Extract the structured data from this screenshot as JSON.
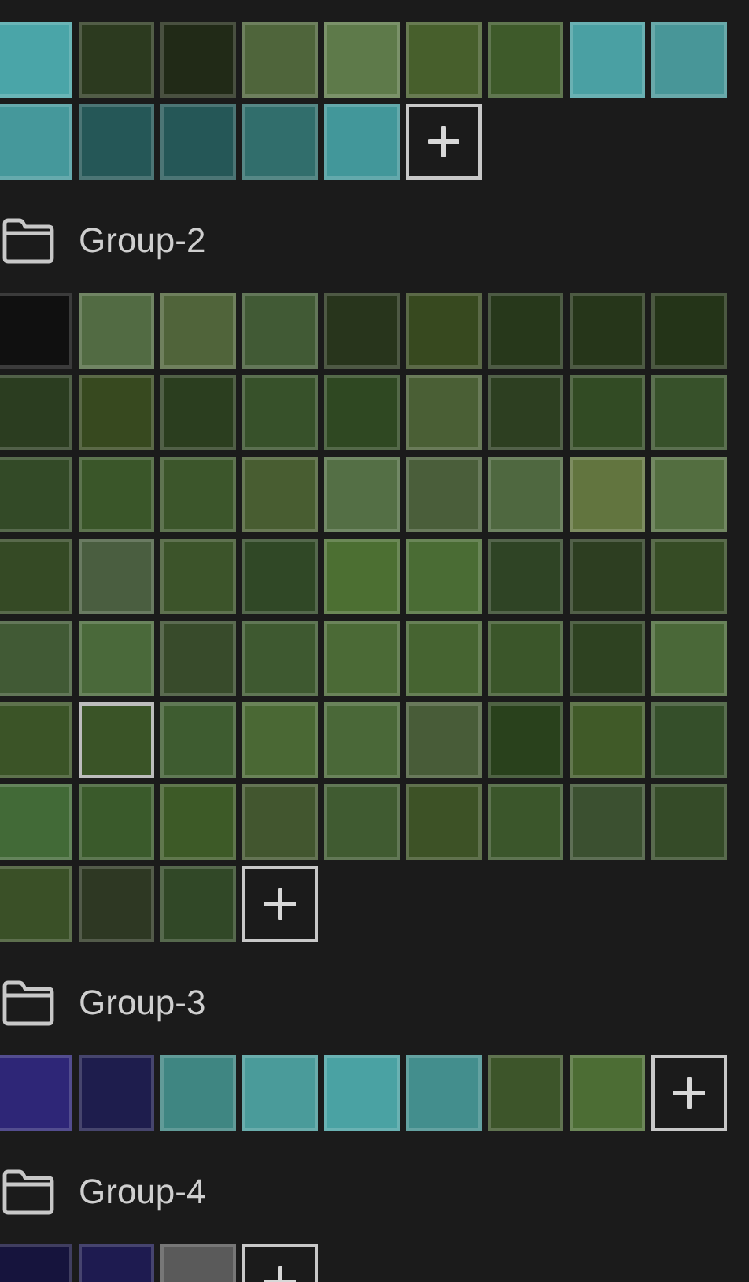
{
  "groups": [
    {
      "swatches": [
        {
          "color": "#4aa5a8",
          "selected": false
        },
        {
          "color": "#2c3a1f",
          "selected": false
        },
        {
          "color": "#212a17",
          "selected": false
        },
        {
          "color": "#4f653b",
          "selected": false
        },
        {
          "color": "#5e7a4a",
          "selected": false
        },
        {
          "color": "#475f2c",
          "selected": false
        },
        {
          "color": "#3e5a2a",
          "selected": false
        },
        {
          "color": "#4aa0a3",
          "selected": false
        },
        {
          "color": "#489698",
          "selected": false
        },
        {
          "color": "#45989b",
          "selected": false
        },
        {
          "color": "#255757",
          "selected": false
        },
        {
          "color": "#255757",
          "selected": false
        },
        {
          "color": "#316e6c",
          "selected": false
        },
        {
          "color": "#42979a",
          "selected": false
        }
      ]
    },
    {
      "name": "Group-2",
      "swatches": [
        {
          "color": "#101010",
          "selected": false
        },
        {
          "color": "#526b43",
          "selected": false
        },
        {
          "color": "#50643a",
          "selected": false
        },
        {
          "color": "#415a35",
          "selected": false
        },
        {
          "color": "#28351c",
          "selected": false
        },
        {
          "color": "#37491f",
          "selected": false
        },
        {
          "color": "#27381b",
          "selected": false
        },
        {
          "color": "#26361a",
          "selected": false
        },
        {
          "color": "#243418",
          "selected": false
        },
        {
          "color": "#2b3d20",
          "selected": false
        },
        {
          "color": "#37491f",
          "selected": false
        },
        {
          "color": "#2b3e1f",
          "selected": false
        },
        {
          "color": "#37512a",
          "selected": false
        },
        {
          "color": "#2f4822",
          "selected": false
        },
        {
          "color": "#4a5f35",
          "selected": false
        },
        {
          "color": "#2d3f21",
          "selected": false
        },
        {
          "color": "#324b24",
          "selected": false
        },
        {
          "color": "#37512a",
          "selected": false
        },
        {
          "color": "#334a27",
          "selected": false
        },
        {
          "color": "#3a5629",
          "selected": false
        },
        {
          "color": "#3c562b",
          "selected": false
        },
        {
          "color": "#485d31",
          "selected": false
        },
        {
          "color": "#546f45",
          "selected": false
        },
        {
          "color": "#4a5e3a",
          "selected": false
        },
        {
          "color": "#4f6840",
          "selected": false
        },
        {
          "color": "#62753f",
          "selected": false
        },
        {
          "color": "#536e40",
          "selected": false
        },
        {
          "color": "#354a25",
          "selected": false
        },
        {
          "color": "#4a5e40",
          "selected": false
        },
        {
          "color": "#3c542a",
          "selected": false
        },
        {
          "color": "#304826",
          "selected": false
        },
        {
          "color": "#4c6f32",
          "selected": false
        },
        {
          "color": "#4a6c34",
          "selected": false
        },
        {
          "color": "#2f4425",
          "selected": false
        },
        {
          "color": "#2d3e21",
          "selected": false
        },
        {
          "color": "#364c25",
          "selected": false
        },
        {
          "color": "#415a35",
          "selected": false
        },
        {
          "color": "#4a693a",
          "selected": false
        },
        {
          "color": "#384b2b",
          "selected": false
        },
        {
          "color": "#3e5930",
          "selected": false
        },
        {
          "color": "#4b6a36",
          "selected": false
        },
        {
          "color": "#466431",
          "selected": false
        },
        {
          "color": "#3b562a",
          "selected": false
        },
        {
          "color": "#2e4221",
          "selected": false
        },
        {
          "color": "#4a6838",
          "selected": false
        },
        {
          "color": "#3b5427",
          "selected": false
        },
        {
          "color": "#3a5427",
          "selected": true
        },
        {
          "color": "#3e5c30",
          "selected": false
        },
        {
          "color": "#4a6834",
          "selected": false
        },
        {
          "color": "#4a6838",
          "selected": false
        },
        {
          "color": "#485c38",
          "selected": false
        },
        {
          "color": "#29411c",
          "selected": false
        },
        {
          "color": "#405a28",
          "selected": false
        },
        {
          "color": "#354f2a",
          "selected": false
        },
        {
          "color": "#426a37",
          "selected": false
        },
        {
          "color": "#3a5a2b",
          "selected": false
        },
        {
          "color": "#3d5a27",
          "selected": false
        },
        {
          "color": "#42562f",
          "selected": false
        },
        {
          "color": "#405b31",
          "selected": false
        },
        {
          "color": "#3d5226",
          "selected": false
        },
        {
          "color": "#3b562b",
          "selected": false
        },
        {
          "color": "#3b5030",
          "selected": false
        },
        {
          "color": "#354b28",
          "selected": false
        },
        {
          "color": "#3a5027",
          "selected": false
        },
        {
          "color": "#2e3823",
          "selected": false
        },
        {
          "color": "#314827",
          "selected": false
        }
      ]
    },
    {
      "name": "Group-3",
      "swatches": [
        {
          "color": "#2e2677",
          "selected": false
        },
        {
          "color": "#1e1d4d",
          "selected": false
        },
        {
          "color": "#3f8682",
          "selected": false
        },
        {
          "color": "#4a9b9a",
          "selected": false
        },
        {
          "color": "#4aa2a3",
          "selected": false
        },
        {
          "color": "#438e8d",
          "selected": false
        },
        {
          "color": "#3d552a",
          "selected": false
        },
        {
          "color": "#4c6d34",
          "selected": false
        }
      ]
    },
    {
      "name": "Group-4",
      "swatches": [
        {
          "color": "#16143d",
          "selected": false
        },
        {
          "color": "#1e1b50",
          "selected": false
        },
        {
          "color": "#5a5a5a",
          "selected": false
        }
      ]
    }
  ]
}
